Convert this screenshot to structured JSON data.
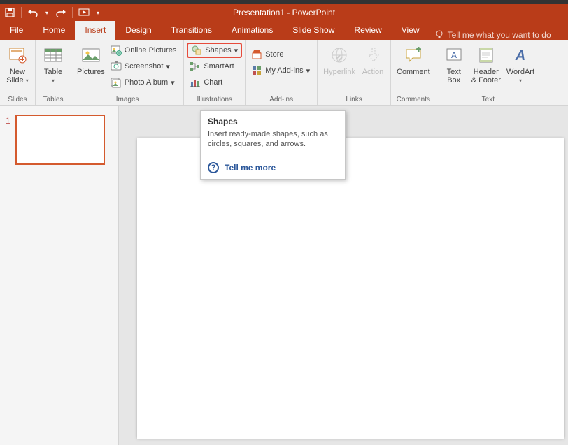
{
  "window": {
    "title": "Presentation1 - PowerPoint"
  },
  "qat": {
    "save": "save-icon",
    "undo": "undo-icon",
    "redo": "redo-icon",
    "startfrom": "start-from-beginning-icon"
  },
  "tabs": {
    "file": "File",
    "home": "Home",
    "insert": "Insert",
    "design": "Design",
    "transitions": "Transitions",
    "animations": "Animations",
    "slideshow": "Slide Show",
    "review": "Review",
    "view": "View",
    "tellme": "Tell me what you want to do"
  },
  "ribbon": {
    "slides": {
      "groupLabel": "Slides",
      "newSlide": "New\nSlide"
    },
    "tables": {
      "groupLabel": "Tables",
      "table": "Table"
    },
    "images": {
      "groupLabel": "Images",
      "pictures": "Pictures",
      "onlinePictures": "Online Pictures",
      "screenshot": "Screenshot",
      "photoAlbum": "Photo Album"
    },
    "illustrations": {
      "groupLabel": "Illustrations",
      "shapes": "Shapes",
      "smartart": "SmartArt",
      "chart": "Chart"
    },
    "addins": {
      "groupLabel": "Add-ins",
      "store": "Store",
      "myaddins": "My Add-ins"
    },
    "links": {
      "groupLabel": "Links",
      "hyperlink": "Hyperlink",
      "action": "Action"
    },
    "comments": {
      "groupLabel": "Comments",
      "comment": "Comment"
    },
    "text": {
      "groupLabel": "Text",
      "textbox": "Text\nBox",
      "headerfooter": "Header\n& Footer",
      "wordart": "WordArt"
    }
  },
  "tooltip": {
    "title": "Shapes",
    "body": "Insert ready-made shapes, such as circles, squares, and arrows.",
    "link": "Tell me more"
  },
  "thumbs": {
    "slide1Num": "1"
  },
  "colors": {
    "brand": "#b93c19",
    "highlight": "#e74c3c"
  }
}
